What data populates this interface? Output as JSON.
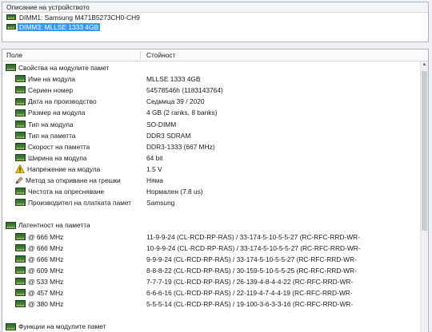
{
  "device_panel": {
    "title": "Описание на устройството",
    "devices": [
      {
        "label": "DIMM1: Samsung M471B5273CH0-CH9",
        "selected": false
      },
      {
        "label": "DIMM3: MLLSE 1333 4GB",
        "selected": true
      }
    ]
  },
  "properties": {
    "columns": {
      "field": "Поле",
      "value": "Стойност"
    },
    "sections": [
      {
        "title": "Свойства на модулите памет",
        "rows": [
          {
            "field": "Име на модула",
            "value": "MLLSE 1333 4GB",
            "icon": "memory-chip-icon"
          },
          {
            "field": "Сериен номер",
            "value": "54578546h (1183143764)",
            "icon": "memory-chip-icon"
          },
          {
            "field": "Дата на производство",
            "value": "Седмица 39 / 2020",
            "icon": "memory-chip-icon"
          },
          {
            "field": "Размер на модула",
            "value": "4 GB (2 ranks, 8 banks)",
            "icon": "memory-chip-icon"
          },
          {
            "field": "Тип на модула",
            "value": "SO-DIMM",
            "icon": "memory-chip-icon"
          },
          {
            "field": "Тип на паметта",
            "value": "DDR3 SDRAM",
            "icon": "memory-chip-icon"
          },
          {
            "field": "Скорост на паметта",
            "value": "DDR3-1333 (667 MHz)",
            "icon": "memory-chip-icon"
          },
          {
            "field": "Ширина на модула",
            "value": "64 bit",
            "icon": "memory-chip-icon"
          },
          {
            "field": "Напрежение на модула",
            "value": "1.5 V",
            "icon": "warning-icon"
          },
          {
            "field": "Метод за откриване на грешки",
            "value": "Няма",
            "icon": "pencil-icon"
          },
          {
            "field": "Честота на опресняване",
            "value": "Нормален (7.8 us)",
            "icon": "memory-chip-icon"
          },
          {
            "field": "Производител на платката памет",
            "value": "Samsung",
            "icon": "memory-chip-icon"
          }
        ]
      },
      {
        "title": "Латентност на паметта",
        "rows": [
          {
            "field": "@ 666 MHz",
            "value": "11-9-9-24  (CL-RCD-RP-RAS) / 33-174-5-10-5-5-27  (RC-RFC-RRD-WR-",
            "icon": "memory-chip-icon"
          },
          {
            "field": "@ 666 MHz",
            "value": "10-9-9-24  (CL-RCD-RP-RAS) / 33-174-5-10-5-5-27  (RC-RFC-RRD-WR-",
            "icon": "memory-chip-icon"
          },
          {
            "field": "@ 666 MHz",
            "value": "9-9-9-24  (CL-RCD-RP-RAS) / 33-174-5-10-5-5-27  (RC-RFC-RRD-WR-",
            "icon": "memory-chip-icon"
          },
          {
            "field": "@ 609 MHz",
            "value": "8-8-8-22  (CL-RCD-RP-RAS) / 30-159-5-10-5-5-25  (RC-RFC-RRD-WR-",
            "icon": "memory-chip-icon"
          },
          {
            "field": "@ 533 MHz",
            "value": "7-7-7-19  (CL-RCD-RP-RAS) / 26-139-4-8-4-4-22  (RC-RFC-RRD-WR-",
            "icon": "memory-chip-icon"
          },
          {
            "field": "@ 457 MHz",
            "value": "6-6-6-16  (CL-RCD-RP-RAS) / 22-119-4-7-4-4-19  (RC-RFC-RRD-WR-",
            "icon": "memory-chip-icon"
          },
          {
            "field": "@ 380 MHz",
            "value": "5-5-5-14  (CL-RCD-RP-RAS) / 19-100-3-6-3-3-16  (RC-RFC-RRD-WR-",
            "icon": "memory-chip-icon"
          }
        ]
      },
      {
        "title": "Функции на модулите памет",
        "rows": []
      }
    ]
  },
  "colors": {
    "selection": "#3399ff",
    "chip": "#3f8a3a",
    "warning": "#f2c200"
  }
}
